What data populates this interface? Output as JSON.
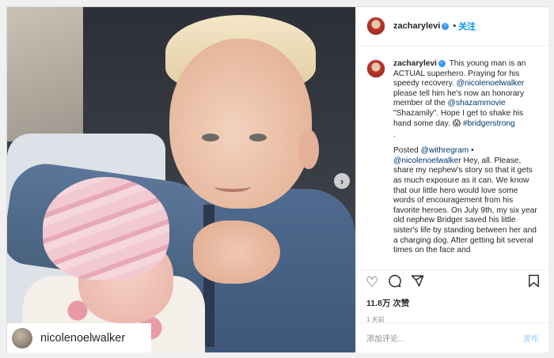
{
  "post": {
    "author": "zacharylevi",
    "follow_label": "关注",
    "separator": "•",
    "tagged_user": "nicolenoelwalker",
    "next_arrow": "›"
  },
  "caption": {
    "username": "zacharylevi",
    "text_1": " This young man is an ACTUAL superhero. Praying for his speedy recovery. ",
    "mention_1": "@nicolenoelwalker",
    "text_2": " please tell him he's now an honorary member of the ",
    "mention_2": "@shazammovie",
    "text_3": " \"Shazamily\". Hope I get to shake his hand some day. 😱 ",
    "hashtag": "#bridgerstrong",
    "dot": ".",
    "posted_label": "Posted ",
    "mention_3": "@withregram",
    "separator": " • ",
    "mention_4": "@nicolenoelwalker",
    "text_4": " Hey, all. Please, share my nephew's story so that it gets as much exposure as it can. We know that our little hero would love some words of encouragement from his favorite heroes. On July 9th, my six year old nephew Bridger saved his little sister's life by standing between her and a charging dog. After getting bit several times on the face and"
  },
  "actions": {
    "like_icon": "heart-icon",
    "comment_icon": "comment-icon",
    "share_icon": "share-icon",
    "save_icon": "bookmark-icon",
    "likes": "11.8万 次赞",
    "time": "1 天前",
    "add_comment_placeholder": "添加评论...",
    "post_label": "发布"
  },
  "colors": {
    "accent": "#0095f6",
    "link": "#00376b",
    "verified": "#3897f0"
  }
}
